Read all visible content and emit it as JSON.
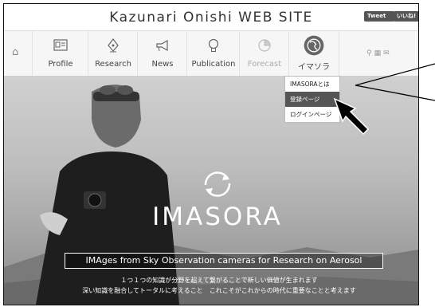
{
  "header": {
    "site_title": "Kazunari Onishi WEB SITE",
    "tweet_label": "Tweet",
    "like_label": "いいね!"
  },
  "nav": {
    "items": [
      {
        "label": "Profile",
        "icon": "profile-card-icon"
      },
      {
        "label": "Research",
        "icon": "pen-nib-icon"
      },
      {
        "label": "News",
        "icon": "megaphone-icon"
      },
      {
        "label": "Publication",
        "icon": "lightbulb-icon"
      },
      {
        "label": "Forecast",
        "icon": "pie-chart-icon"
      },
      {
        "label": "イマソラ",
        "icon": "globe-icon"
      }
    ],
    "home_icon": "home-icon",
    "util_icons": [
      "key-icon",
      "sitemap-icon",
      "mail-icon"
    ]
  },
  "dropdown": {
    "items": [
      "IMASORAとは",
      "登録ページ",
      "ログインページ"
    ],
    "active_index": 1
  },
  "hero": {
    "logo_text": "IMASORA",
    "tagline": "IMAges from Sky Observation cameras for Research on Aerosol",
    "jp_line1": "１つ１つの知識が分野を超えて繋がることで新しい価値が生まれます",
    "jp_line2": "深い知識を融合してトータルに考えること　これこそがこれからの時代に重要なことと考えます"
  },
  "colors": {
    "dropdown_active_bg": "#555555",
    "nav_bg": "#f6f6f6"
  }
}
